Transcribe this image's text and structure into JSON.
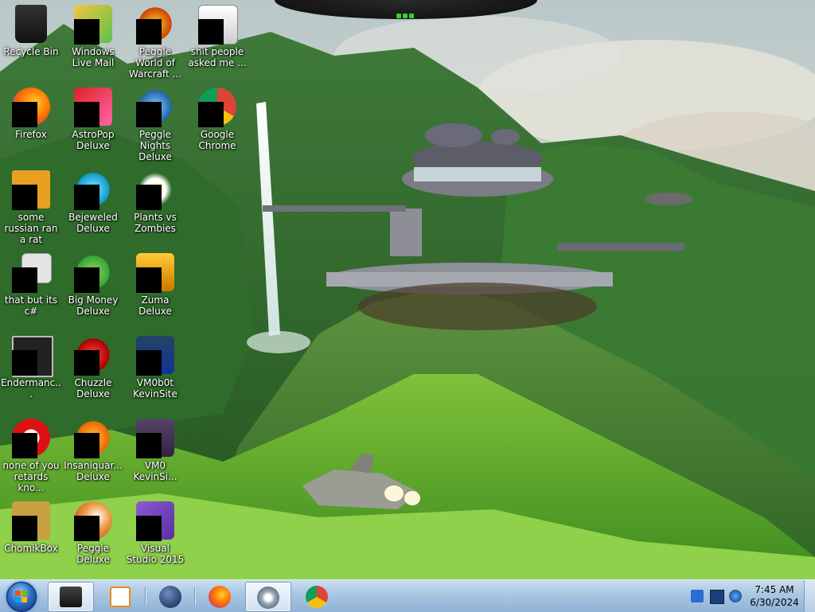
{
  "desktop": {
    "icons": [
      {
        "label": "Recycle Bin",
        "icon": "recycle-bin-icon"
      },
      {
        "label": "Windows Live Mail",
        "icon": "windows-live-mail-icon"
      },
      {
        "label": "Peggle World of Warcraft ...",
        "icon": "peggle-wow-icon"
      },
      {
        "label": "shit people asked me ...",
        "icon": "folder-icon"
      },
      {
        "label": "Firefox",
        "icon": "firefox-icon"
      },
      {
        "label": "AstroPop Deluxe",
        "icon": "astropop-icon"
      },
      {
        "label": "Peggle Nights Deluxe",
        "icon": "peggle-nights-icon"
      },
      {
        "label": "Google Chrome",
        "icon": "chrome-icon"
      },
      {
        "label": "some russian ran a rat",
        "icon": "java-file-icon"
      },
      {
        "label": "Bejeweled Deluxe",
        "icon": "bejeweled-icon"
      },
      {
        "label": "Plants vs Zombies",
        "icon": "plants-vs-zombies-icon"
      },
      {
        "label": "that but its c#",
        "icon": "document-stack-icon"
      },
      {
        "label": "Big Money Deluxe",
        "icon": "big-money-icon"
      },
      {
        "label": "Zuma Deluxe",
        "icon": "zuma-icon"
      },
      {
        "label": "Endermanc...",
        "icon": "console-app-icon"
      },
      {
        "label": "Chuzzle Deluxe",
        "icon": "chuzzle-icon"
      },
      {
        "label": "VM0b0t KevinSite",
        "icon": "vm-shortcut-icon"
      },
      {
        "label": "none of you retards kno...",
        "icon": "opera-icon"
      },
      {
        "label": "Insaniquar... Deluxe",
        "icon": "insaniquarium-icon"
      },
      {
        "label": "VM0 KevinSi...",
        "icon": "vm-shortcut-icon"
      },
      {
        "label": "ChomikBox",
        "icon": "chomikbox-icon"
      },
      {
        "label": "Peggle Deluxe",
        "icon": "peggle-icon"
      },
      {
        "label": "Visual Studio 2015",
        "icon": "visual-studio-icon"
      }
    ]
  },
  "taskbar": {
    "start_icon": "windows-start-orb-icon",
    "pinned": [
      {
        "name": "app-window-icon",
        "active": true
      },
      {
        "name": "media-player-icon",
        "active": false
      },
      {
        "name": "globe-app-icon",
        "active": false
      },
      {
        "name": "firefox-icon",
        "active": false
      },
      {
        "name": "media-center-icon",
        "active": true
      },
      {
        "name": "chrome-icon",
        "active": false
      }
    ],
    "tray": {
      "icons": [
        "network-icon",
        "display-icon",
        "volume-icon"
      ],
      "time": "7:45 AM",
      "date": "6/30/2024"
    }
  },
  "colors": {
    "taskbar_top": "#c9ddef",
    "taskbar_bottom": "#8fb3d6",
    "gadget_led": "#2fd02f"
  }
}
